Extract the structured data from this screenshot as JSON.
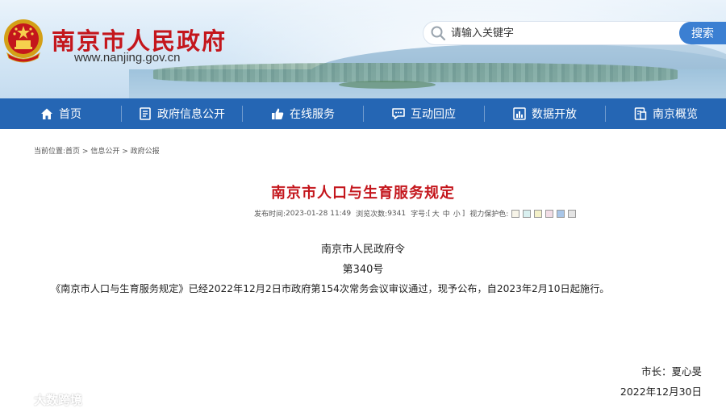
{
  "header": {
    "site_title": "南京市人民政府",
    "site_url": "www.nanjing.gov.cn",
    "search": {
      "placeholder": "请输入关键字",
      "button_label": "搜索"
    }
  },
  "nav": {
    "items": [
      {
        "label": "首页",
        "icon": "home-icon"
      },
      {
        "label": "政府信息公开",
        "icon": "document-icon"
      },
      {
        "label": "在线服务",
        "icon": "thumbs-up-icon"
      },
      {
        "label": "互动回应",
        "icon": "chat-icon"
      },
      {
        "label": "数据开放",
        "icon": "bar-chart-icon"
      },
      {
        "label": "南京概览",
        "icon": "overview-icon"
      }
    ]
  },
  "breadcrumb": {
    "prefix": "当前位置:",
    "items": [
      "首页",
      "信息公开",
      "政府公报"
    ],
    "separator": " > "
  },
  "article": {
    "title": "南京市人口与生育服务规定",
    "meta": {
      "publish_label": "发布时间:",
      "publish_time": "2023-01-28 11:49",
      "views_label": "浏览次数:",
      "views": "9341",
      "font_size_label": "字号:",
      "font_size_open": "[",
      "font_sizes": [
        "大",
        "中",
        "小"
      ],
      "font_size_close": "]",
      "eye_care_label": "视力保护色:",
      "eye_care_colors": [
        "#f7f4e8",
        "#d9f0f0",
        "#f3f0c8",
        "#f2dde6",
        "#a9c6e8",
        "#e4e4e4"
      ]
    },
    "decree_issuer": "南京市人民政府令",
    "decree_number": "第340号",
    "body": "《南京市人口与生育服务规定》已经2022年12月2日市政府第154次常务会议审议通过，现予公布，自2023年2月10日起施行。",
    "signature": "市长：夏心旻",
    "date": "2022年12月30日"
  },
  "watermark": {
    "text": "大数跨境"
  },
  "colors": {
    "brand_red": "#c4161c",
    "nav_blue": "#2566b4",
    "search_blue": "#3b7fd2"
  }
}
